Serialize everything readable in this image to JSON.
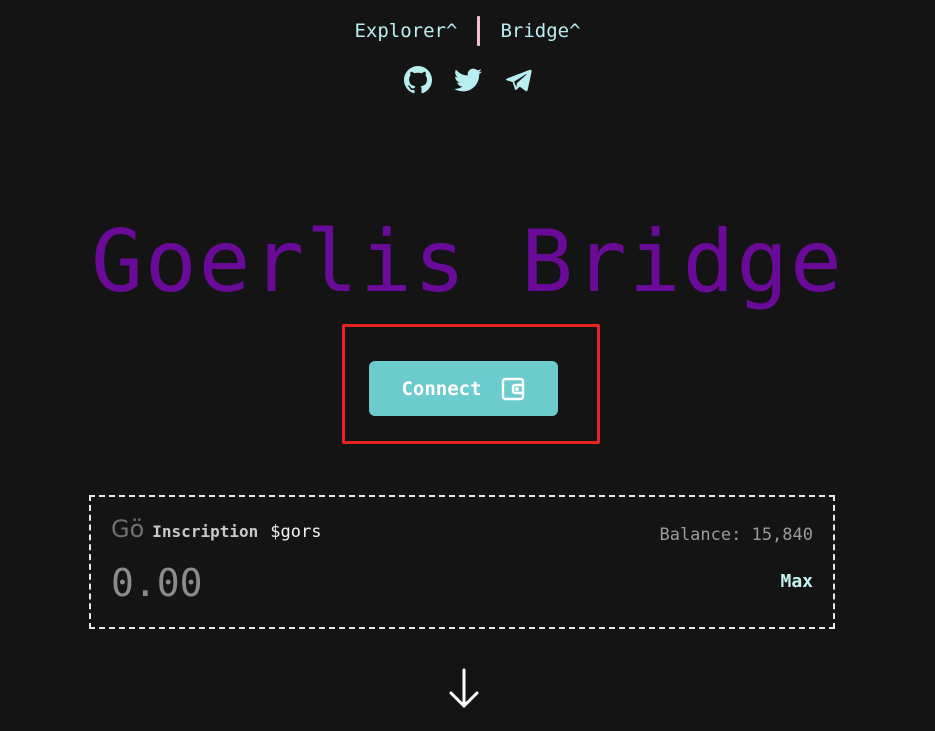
{
  "nav": {
    "explorer_label": "Explorer^",
    "bridge_label": "Bridge^"
  },
  "socials": {
    "icons": [
      "github-icon",
      "twitter-icon",
      "telegram-icon"
    ]
  },
  "hero": {
    "title": "Goerlis Bridge"
  },
  "connect": {
    "label": "Connect",
    "icon": "wallet-icon"
  },
  "token_panel": {
    "logo_text": "Gö",
    "name": "Inscription",
    "symbol": "$gors",
    "balance": "Balance: 15,840",
    "amount_placeholder": "0.00",
    "max_label": "Max"
  },
  "colors": {
    "background": "#141414",
    "accent_teal": "#6ccbcc",
    "nav_text": "#b9eef0",
    "title_purple": "#6a0a98",
    "highlight_red": "#e62424"
  }
}
